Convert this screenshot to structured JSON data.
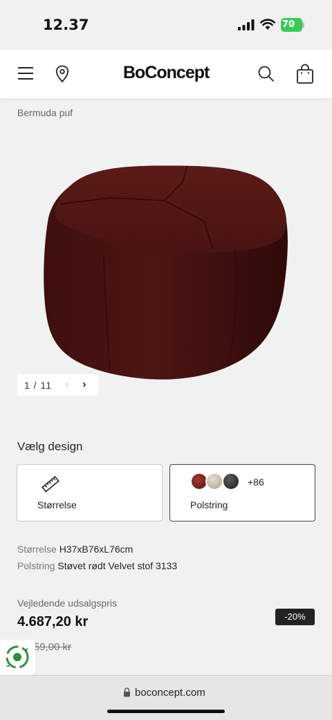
{
  "status_bar": {
    "time": "12.37",
    "battery": "70"
  },
  "header": {
    "logo": "BoConcept"
  },
  "product": {
    "title": "Bermuda puf"
  },
  "gallery": {
    "pager": "1 / 11"
  },
  "design": {
    "heading": "Vælg design",
    "options": [
      {
        "label": "Størrelse",
        "icon": "ruler-icon"
      },
      {
        "label": "Polstring",
        "more_count": "+86",
        "swatch_colors": [
          "#7a2019",
          "#d2c8b8",
          "#3a3a3a"
        ]
      }
    ]
  },
  "specs": [
    {
      "key": "Størrelse",
      "value": "H37xB76xL76cm"
    },
    {
      "key": "Polstring",
      "value": "Støvet rødt Velvet stof 3133"
    }
  ],
  "pricing": {
    "caption": "Vejledende udsalgspris",
    "price": "4.687,20 kr",
    "discount": "-20%",
    "old_price": "5.859,00 kr"
  },
  "browser": {
    "url": "boconcept.com"
  },
  "colors": {
    "accent": "#222222",
    "product": "#5a1a18",
    "battery": "#3dc95a"
  }
}
